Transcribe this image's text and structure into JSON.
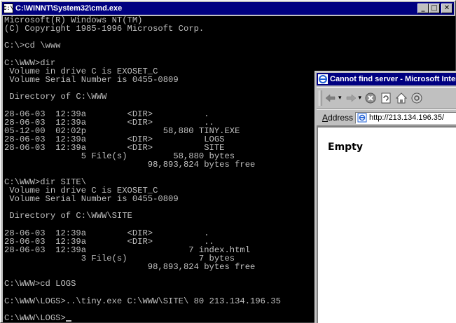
{
  "cmd": {
    "title": "C:\\WINNT\\System32\\cmd.exe",
    "icon": "cmd-icon",
    "controls": {
      "minimize": "_",
      "maximize": "□",
      "close": "✕"
    },
    "lines": [
      "Microsoft(R) Windows NT(TM)",
      "(C) Copyright 1985-1996 Microsoft Corp.",
      "",
      "C:\\>cd \\www",
      "",
      "C:\\WWW>dir",
      " Volume in drive C is EXOSET_C",
      " Volume Serial Number is 0455-0809",
      "",
      " Directory of C:\\WWW",
      "",
      "28-06-03  12:39a        <DIR>          .",
      "28-06-03  12:39a        <DIR>          ..",
      "05-12-00  02:02p               58,880 TINY.EXE",
      "28-06-03  12:39a        <DIR>          LOGS",
      "28-06-03  12:39a        <DIR>          SITE",
      "               5 File(s)         58,880 bytes",
      "                            98,893,824 bytes free",
      "",
      "C:\\WWW>dir SITE\\",
      " Volume in drive C is EXOSET_C",
      " Volume Serial Number is 0455-0809",
      "",
      " Directory of C:\\WWW\\SITE",
      "",
      "28-06-03  12:39a        <DIR>          .",
      "28-06-03  12:39a        <DIR>          ..",
      "28-06-03  12:39a                    7 index.html",
      "               3 File(s)              7 bytes",
      "                            98,893,824 bytes free",
      "",
      "C:\\WWW>cd LOGS",
      "",
      "C:\\WWW\\LOGS>..\\tiny.exe C:\\WWW\\SITE\\ 80 213.134.196.35",
      "",
      "C:\\WWW\\LOGS>"
    ]
  },
  "ie": {
    "title": "Cannot find server - Microsoft Internet Explorer",
    "address_label": "Address",
    "address_value": "http://213.134.196.35/",
    "page_text": "Empty",
    "toolbar_icons": [
      "back-icon",
      "forward-icon",
      "stop-icon",
      "refresh-icon",
      "home-icon",
      "search-icon"
    ]
  },
  "colors": {
    "titlebar": "#000080",
    "console_bg": "#000000",
    "console_fg": "#c0c0c0",
    "chrome": "#c0c0c0"
  }
}
